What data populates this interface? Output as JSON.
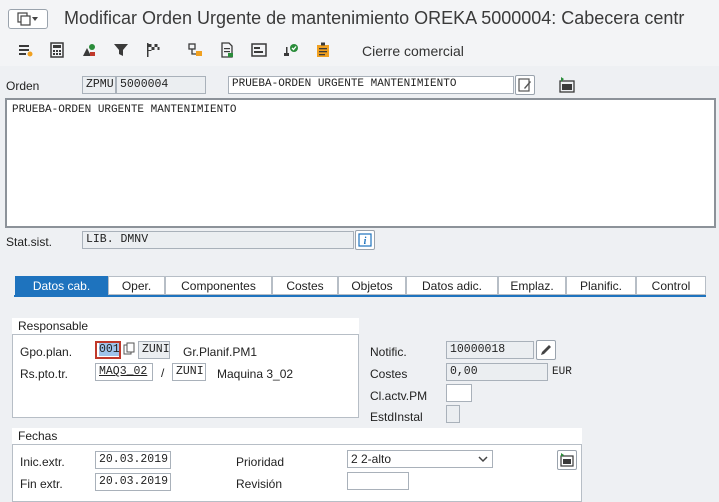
{
  "window": {
    "title": "Modificar Orden Urgente de mantenimiento OREKA 5000004: Cabecera centr"
  },
  "toolbar": {
    "icons": [
      "list-icon",
      "calculator-icon",
      "materials-icon",
      "funnel-icon",
      "flag-icon",
      "hierarchy-icon",
      "document-icon",
      "layout-icon",
      "person-check-icon",
      "save-list-icon"
    ],
    "cierre_label": "Cierre comercial"
  },
  "orden": {
    "label": "Orden",
    "type": "ZPMU",
    "number": "5000004",
    "description": "PRUEBA-ORDEN URGENTE MANTENIMIENTO",
    "long_text": "PRUEBA-ORDEN URGENTE MANTENIMIENTO"
  },
  "status": {
    "label": "Stat.sist.",
    "value": "LIB. DMNV"
  },
  "tabs": [
    {
      "label": "Datos cab.",
      "active": true
    },
    {
      "label": "Oper."
    },
    {
      "label": "Componentes"
    },
    {
      "label": "Costes"
    },
    {
      "label": "Objetos"
    },
    {
      "label": "Datos adic."
    },
    {
      "label": "Emplaz."
    },
    {
      "label": "Planific."
    },
    {
      "label": "Control"
    }
  ],
  "responsable": {
    "header": "Responsable",
    "gpo_plan_label": "Gpo.plan.",
    "gpo_plan_value": "001",
    "gpo_plan_center": "ZUNI",
    "gpo_plan_desc": "Gr.Planif.PM1",
    "rs_pto_label": "Rs.pto.tr.",
    "rs_pto_value": "MAQ3_02",
    "rs_pto_sep": "/",
    "rs_pto_center": "ZUNI",
    "rs_pto_desc": "Maquina 3_02"
  },
  "right_panel": {
    "notific_label": "Notific.",
    "notific_value": "10000018",
    "costes_label": "Costes",
    "costes_value": "0,00",
    "currency": "EUR",
    "clactv_label": "Cl.actv.PM",
    "clactv_value": "",
    "estd_label": "EstdInstal",
    "estd_value": ""
  },
  "fechas": {
    "header": "Fechas",
    "inic_label": "Inic.extr.",
    "inic_value": "20.03.2019",
    "fin_label": "Fin extr.",
    "fin_value": "20.03.2019",
    "prioridad_label": "Prioridad",
    "prioridad_value": "2 2-alto",
    "revision_label": "Revisión",
    "revision_value": ""
  }
}
